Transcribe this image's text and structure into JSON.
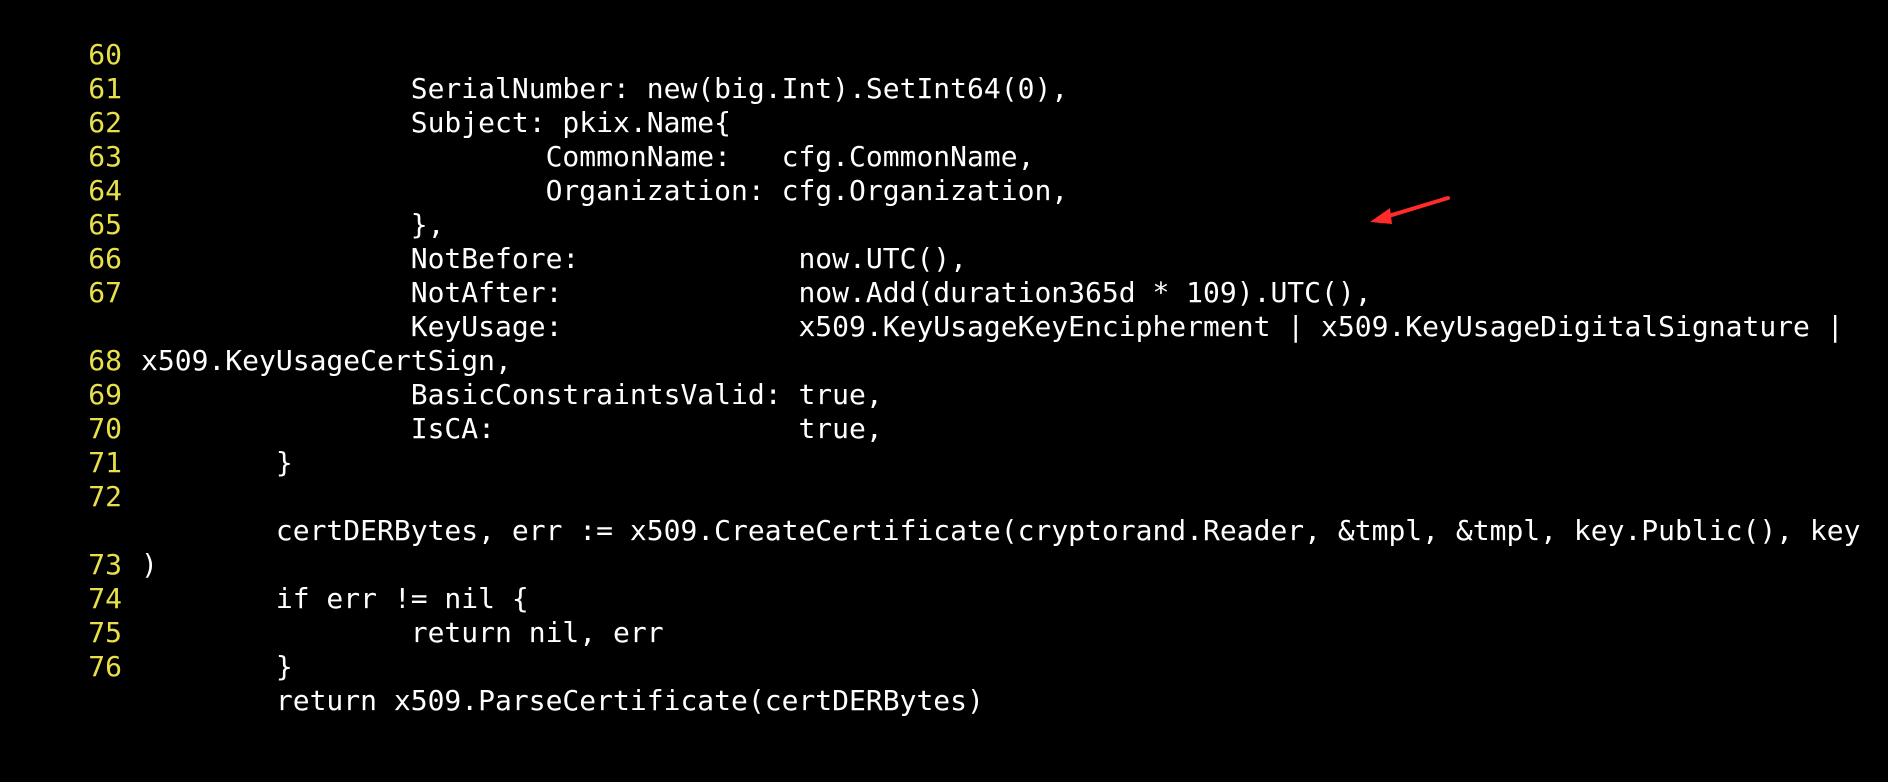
{
  "editor": {
    "line_number_color": "#e8e04a",
    "text_color": "#ffffff",
    "background_color": "#000000",
    "lines": [
      {
        "number": "60",
        "text": "                SerialNumber: new(big.Int).SetInt64(0),"
      },
      {
        "number": "61",
        "text": "                Subject: pkix.Name{"
      },
      {
        "number": "62",
        "text": "                        CommonName:   cfg.CommonName,"
      },
      {
        "number": "63",
        "text": "                        Organization: cfg.Organization,"
      },
      {
        "number": "64",
        "text": "                },"
      },
      {
        "number": "65",
        "text": "                NotBefore:             now.UTC(),"
      },
      {
        "number": "66",
        "text": "                NotAfter:              now.Add(duration365d * 109).UTC(),"
      },
      {
        "number": "67",
        "text": "                KeyUsage:              x509.KeyUsageKeyEncipherment | x509.KeyUsageDigitalSignature |"
      },
      {
        "number": "",
        "text": "x509.KeyUsageCertSign,"
      },
      {
        "number": "68",
        "text": "                BasicConstraintsValid: true,"
      },
      {
        "number": "69",
        "text": "                IsCA:                  true,"
      },
      {
        "number": "70",
        "text": "        }"
      },
      {
        "number": "71",
        "text": ""
      },
      {
        "number": "72",
        "text": "        certDERBytes, err := x509.CreateCertificate(cryptorand.Reader, &tmpl, &tmpl, key.Public(), key"
      },
      {
        "number": "",
        "text": ")"
      },
      {
        "number": "73",
        "text": "        if err != nil {"
      },
      {
        "number": "74",
        "text": "                return nil, err"
      },
      {
        "number": "75",
        "text": "        }"
      },
      {
        "number": "76",
        "text": "        return x509.ParseCertificate(certDERBytes)"
      }
    ]
  },
  "annotation": {
    "icon": "red-arrow-icon",
    "color": "#ff2a2a"
  }
}
